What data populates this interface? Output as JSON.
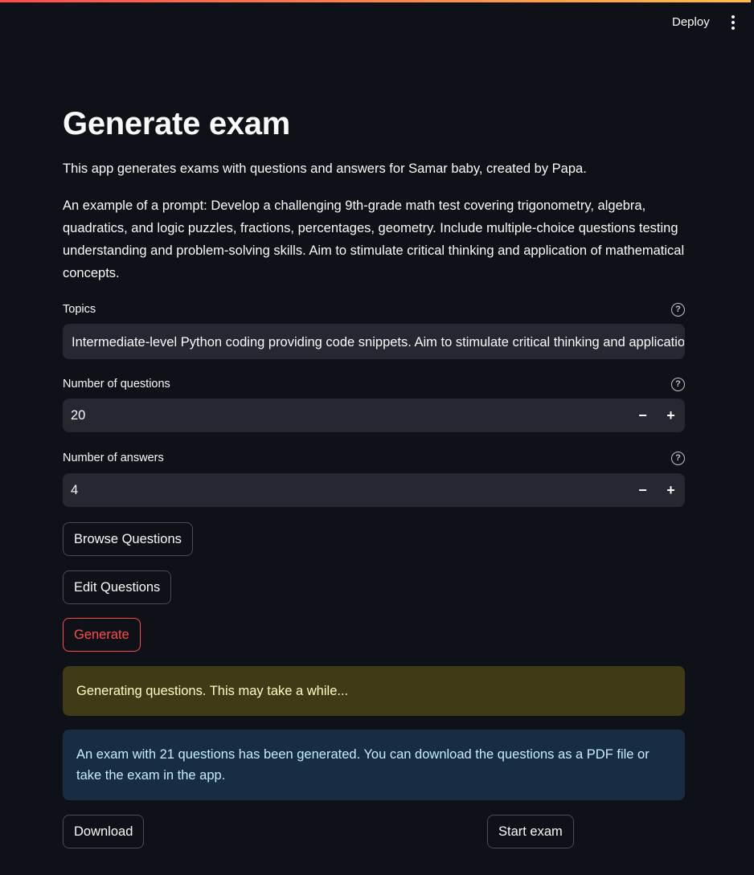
{
  "header": {
    "deploy_label": "Deploy",
    "menu_icon": "vertical-dots-icon"
  },
  "page": {
    "title": "Generate exam",
    "description": "This app generates exams with questions and answers for Samar baby, created by Papa.",
    "example": "An example of a prompt: Develop a challenging 9th-grade math test covering trigonometry, algebra, quadratics, and logic puzzles, fractions, percentages, geometry. Include multiple-choice questions testing understanding and problem-solving skills. Aim to stimulate critical thinking and application of mathematical concepts."
  },
  "form": {
    "topics": {
      "label": "Topics",
      "value": "Intermediate-level Python coding providing code snippets. Aim to stimulate critical thinking and application",
      "help_icon": "question-circle-icon"
    },
    "num_questions": {
      "label": "Number of questions",
      "value": "20",
      "minus": "−",
      "plus": "+"
    },
    "num_answers": {
      "label": "Number of answers",
      "value": "4",
      "minus": "−",
      "plus": "+"
    },
    "help_glyph": "?"
  },
  "buttons": {
    "browse": "Browse Questions",
    "edit": "Edit Questions",
    "generate": "Generate",
    "download": "Download",
    "start": "Start exam"
  },
  "alerts": {
    "warning": "Generating questions. This may take a while...",
    "info": "An exam with 21 questions has been generated. You can download the questions as a PDF file or take the exam in the app."
  },
  "colors": {
    "background": "#0e1117",
    "input_bg": "#262730",
    "accent_red": "#ff4b4b",
    "warning_bg": "#3e3b16",
    "info_bg": "#172d43"
  }
}
